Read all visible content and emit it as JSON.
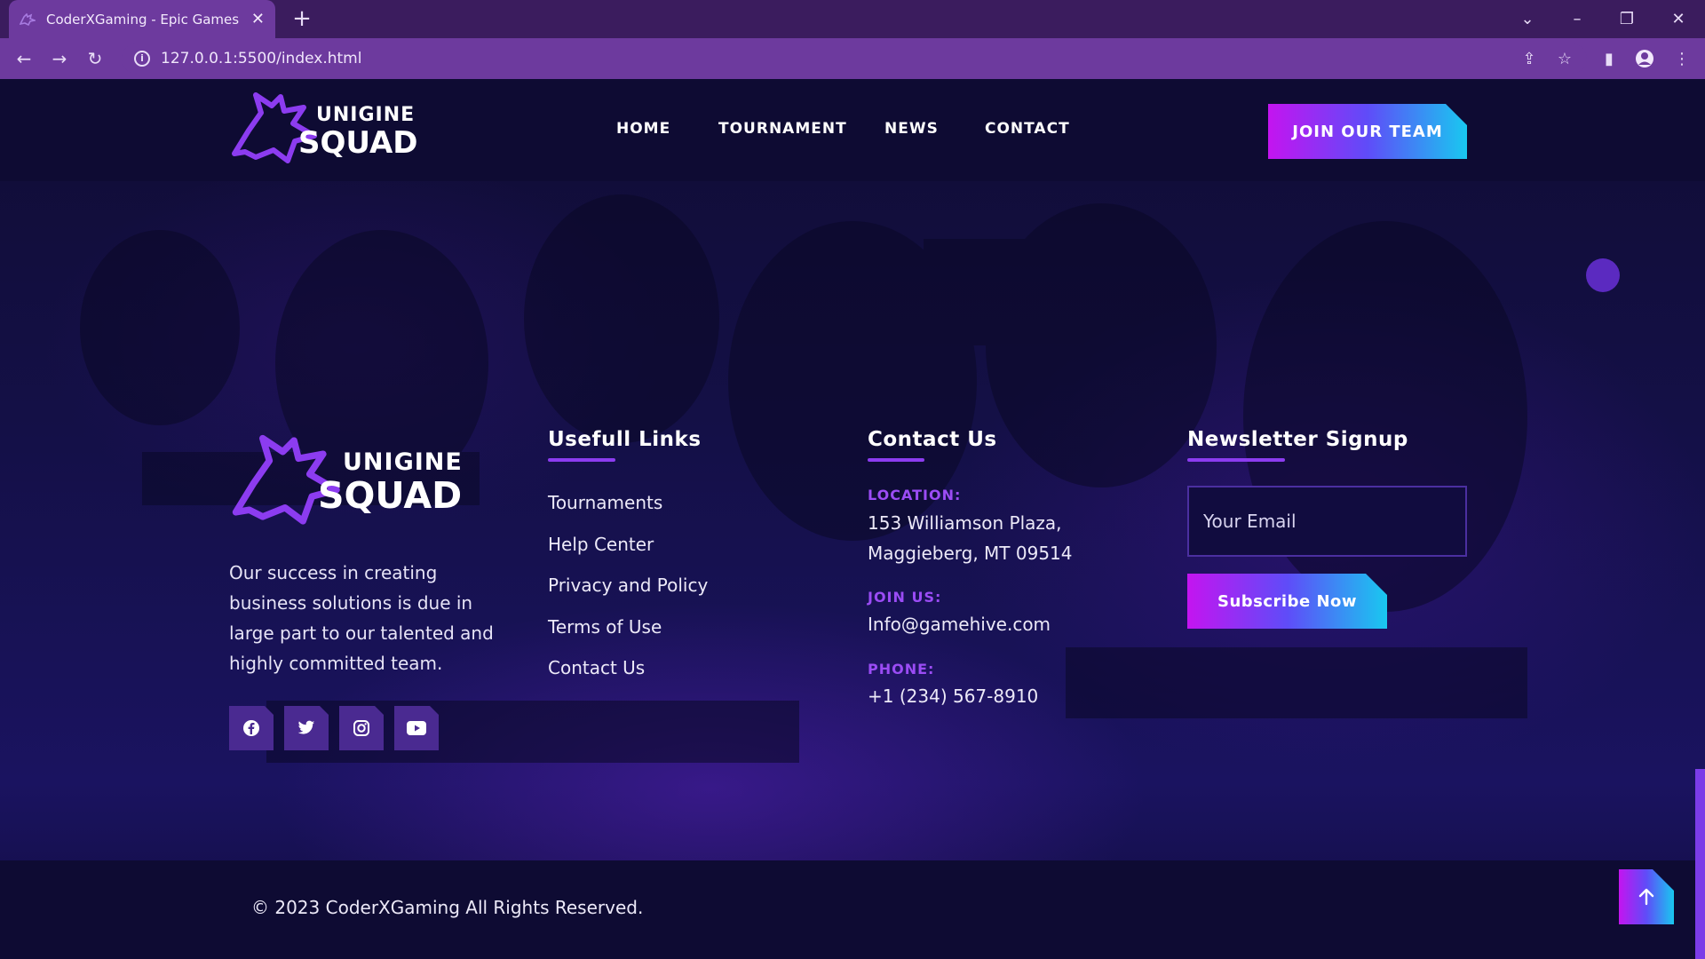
{
  "browser": {
    "tab_title": "CoderXGaming - Epic Games Ma",
    "url": "127.0.0.1:5500/index.html"
  },
  "brand": {
    "word1": "UNIGINE",
    "word2": "SQUAD"
  },
  "nav": {
    "items": [
      "HOME",
      "TOURNAMENT",
      "NEWS",
      "CONTACT"
    ],
    "cta": "JOIN OUR TEAM"
  },
  "footer": {
    "about": "Our success in creating business solutions is due in large part to our talented and highly committed team.",
    "social": [
      "facebook-icon",
      "twitter-icon",
      "instagram-icon",
      "youtube-icon"
    ],
    "links_title": "Usefull Links",
    "links": [
      "Tournaments",
      "Help Center",
      "Privacy and Policy",
      "Terms of Use",
      "Contact Us"
    ],
    "contact_title": "Contact Us",
    "location_label": "LOCATION:",
    "location_line1": "153 Williamson Plaza,",
    "location_line2": "Maggieberg, MT 09514",
    "join_label": "JOIN US:",
    "join_value": "Info@gamehive.com",
    "phone_label": "PHONE:",
    "phone_value": "+1 (234) 567-8910",
    "newsletter_title": "Newsletter Signup",
    "email_placeholder": "Your Email",
    "subscribe_label": "Subscribe Now",
    "copyright": "© 2023 CoderXGaming All Rights Reserved."
  },
  "colors": {
    "accent_purple": "#8c3cf0",
    "gradient_start": "#c414f0",
    "gradient_end": "#19c8f0",
    "background": "#0e0b33"
  }
}
